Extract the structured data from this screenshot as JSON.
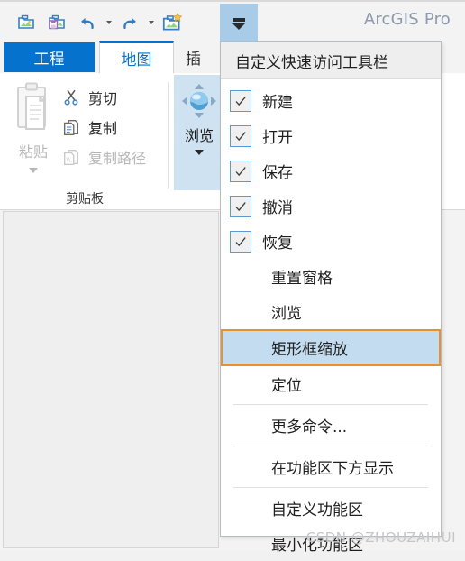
{
  "window": {
    "title": "ArcGIS Pro"
  },
  "quick_access_toolbar": {
    "buttons": [
      {
        "name": "open-project",
        "icon": "open-folder-image-icon",
        "label": "打开"
      },
      {
        "name": "save-project",
        "icon": "save-floppy-icon",
        "label": "保存"
      },
      {
        "name": "undo",
        "icon": "undo-arrow-icon",
        "label": "撤消"
      },
      {
        "name": "redo",
        "icon": "redo-arrow-icon",
        "label": "恢复"
      },
      {
        "name": "new-project",
        "icon": "new-image-star-icon",
        "label": "新建"
      }
    ],
    "toggle_name": "customize-quick-access-toolbar-toggle"
  },
  "ribbon": {
    "tabs": [
      {
        "label": "工程",
        "state": "backstage"
      },
      {
        "label": "地图",
        "state": "active"
      },
      {
        "label": "插",
        "state": "normal"
      }
    ],
    "groups": [
      {
        "label": "剪贴板",
        "paste": {
          "label": "粘贴",
          "enabled": false
        },
        "commands": [
          {
            "label": "剪切",
            "icon": "scissors-icon",
            "enabled": true
          },
          {
            "label": "复制",
            "icon": "copy-pages-icon",
            "enabled": true
          },
          {
            "label": "复制路径",
            "icon": "copy-path-icon",
            "enabled": false
          }
        ]
      },
      {
        "label": "",
        "explore": {
          "label": "浏览",
          "icon": "navigate-globe-icon",
          "selected": true
        }
      }
    ]
  },
  "menu": {
    "header": "自定义快速访问工具栏",
    "items": [
      {
        "label": "新建",
        "type": "checkbox",
        "checked": true
      },
      {
        "label": "打开",
        "type": "checkbox",
        "checked": true
      },
      {
        "label": "保存",
        "type": "checkbox",
        "checked": true
      },
      {
        "label": "撤消",
        "type": "checkbox",
        "checked": true
      },
      {
        "label": "恢复",
        "type": "checkbox",
        "checked": true
      },
      {
        "label": "重置窗格",
        "type": "command",
        "checked": false
      },
      {
        "label": "浏览",
        "type": "command",
        "checked": false
      },
      {
        "label": "矩形框缩放",
        "type": "command",
        "checked": false,
        "highlighted": true
      },
      {
        "label": "定位",
        "type": "command",
        "checked": false
      },
      {
        "label": "更多命令...",
        "type": "command",
        "checked": false
      },
      {
        "label": "在功能区下方显示",
        "type": "command",
        "checked": false
      },
      {
        "label": "自定义功能区",
        "type": "command",
        "checked": false
      },
      {
        "label": "最小化功能区",
        "type": "command",
        "checked": false
      }
    ],
    "highlight_border_color": "#e8912d",
    "highlight_fill_color": "#c3dcf0"
  },
  "watermark": {
    "text": "CSDN @ZHOUZAIHUI"
  },
  "colors": {
    "accent_blue": "#0572ce",
    "selected_blue": "#cfe2f2",
    "title_gray": "#8d99ad"
  }
}
